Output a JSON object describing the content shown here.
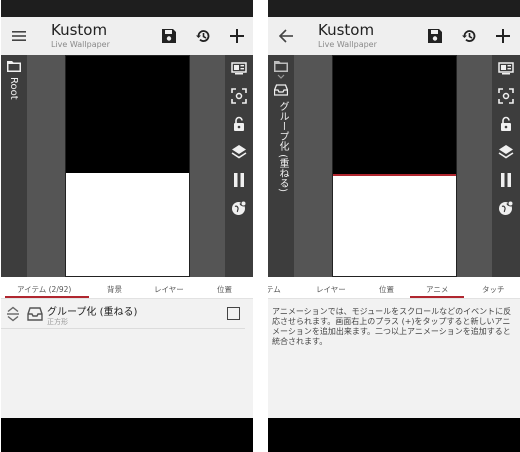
{
  "app": {
    "title": "Kustom",
    "subtitle": "Live Wallpaper"
  },
  "left_screen": {
    "root_label": "Root",
    "tabs": [
      {
        "label": "アイテム (2/92)",
        "active": true
      },
      {
        "label": "背景",
        "active": false
      },
      {
        "label": "レイヤー",
        "active": false
      },
      {
        "label": "位置",
        "active": false
      }
    ],
    "item": {
      "name": "グループ化 (重ねる)",
      "sub": "正方形"
    }
  },
  "right_screen": {
    "group_label": "グループ化 (重ねる)",
    "tabs": [
      {
        "label": "テム",
        "active": false
      },
      {
        "label": "レイヤー",
        "active": false
      },
      {
        "label": "位置",
        "active": false
      },
      {
        "label": "アニメ",
        "active": true
      },
      {
        "label": "タッチ",
        "active": false
      }
    ],
    "description": "アニメーションでは、モジュールをスクロールなどのイベントに反応させられます。画面右上のプラス (+)をタップすると新しいアニメーションを追加出来ます。二つ以上アニメーションを追加すると統合されます。"
  },
  "icons": {
    "left_nav": "menu-icon",
    "right_nav": "back-arrow-icon",
    "actions": [
      "save-icon",
      "history-icon",
      "add-icon"
    ],
    "side_tools": [
      "fullscreen-icon",
      "focus-icon",
      "lock-icon",
      "layers-icon",
      "pause-icon",
      "globe-settings-icon"
    ]
  },
  "colors": {
    "accent": "#b0262f",
    "toolbar": "#3d3d3d",
    "editor_bg": "#555555"
  }
}
